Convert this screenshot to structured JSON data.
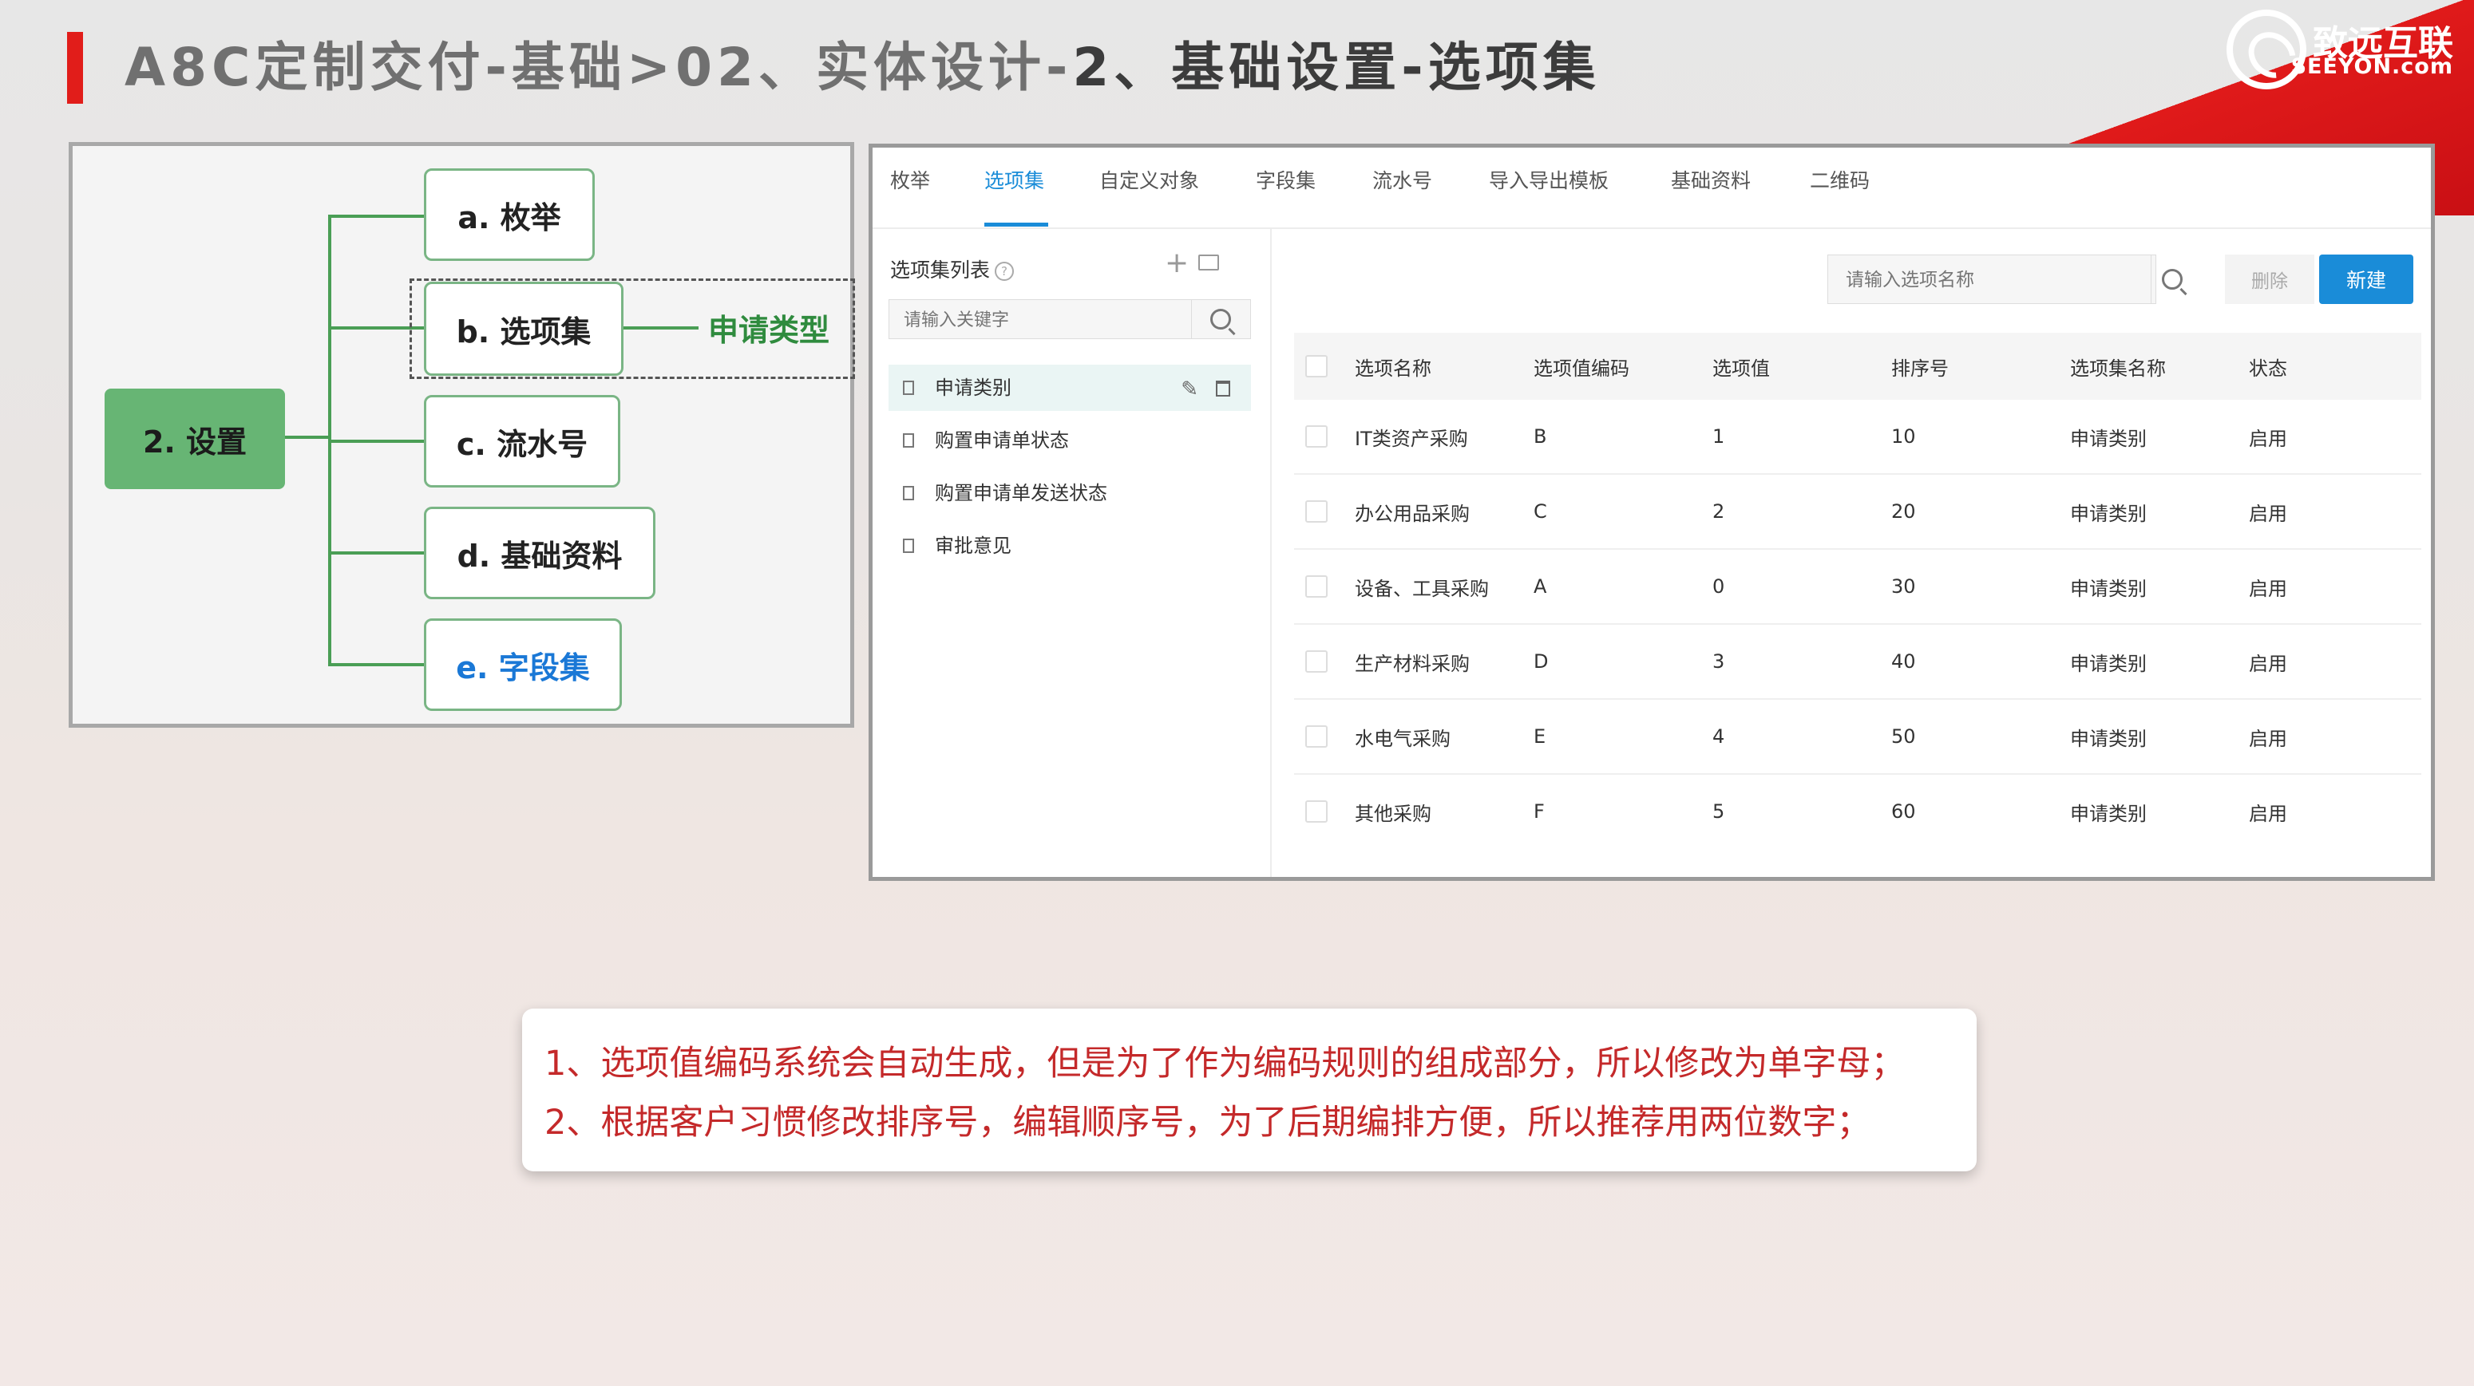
{
  "title": {
    "part1": "A8C定制交付-基础>02、实体设计-",
    "part2": "2、基础设置-选项集"
  },
  "logo": {
    "cn": "致远互联",
    "en": "SEEYON.com"
  },
  "mindmap": {
    "root": "2. 设置",
    "nodes": [
      "a. 枚举",
      "b. 选项集",
      "c. 流水号",
      "d. 基础资料",
      "e. 字段集"
    ],
    "branch_label": "申请类型",
    "highlight_color": "#1a78d6"
  },
  "app": {
    "tabs": [
      "枚举",
      "选项集",
      "自定义对象",
      "字段集",
      "流水号",
      "导入导出模板",
      "基础资料",
      "二维码"
    ],
    "active_tab": "选项集",
    "list_title": "选项集列表",
    "help_icon": "?",
    "keyword_placeholder": "请输入关键字",
    "tree_items": [
      "申请类别",
      "购置申请单状态",
      "购置申请单发送状态",
      "审批意见"
    ],
    "name_placeholder": "请输入选项名称",
    "delete_label": "删除",
    "new_label": "新建",
    "columns": [
      "选项名称",
      "选项值编码",
      "选项值",
      "排序号",
      "选项集名称",
      "状态"
    ],
    "rows": [
      [
        "IT类资产采购",
        "B",
        "1",
        "10",
        "申请类别",
        "启用"
      ],
      [
        "办公用品采购",
        "C",
        "2",
        "20",
        "申请类别",
        "启用"
      ],
      [
        "设备、工具采购",
        "A",
        "0",
        "30",
        "申请类别",
        "启用"
      ],
      [
        "生产材料采购",
        "D",
        "3",
        "40",
        "申请类别",
        "启用"
      ],
      [
        "水电气采购",
        "E",
        "4",
        "50",
        "申请类别",
        "启用"
      ],
      [
        "其他采购",
        "F",
        "5",
        "60",
        "申请类别",
        "启用"
      ]
    ],
    "accent_color": "#1a8cd8"
  },
  "notes": [
    "1、选项值编码系统会自动生成，但是为了作为编码规则的组成部分，所以修改为单字母；",
    "2、根据客户习惯修改排序号，编辑顺序号，为了后期编排方便，所以推荐用两位数字；"
  ]
}
